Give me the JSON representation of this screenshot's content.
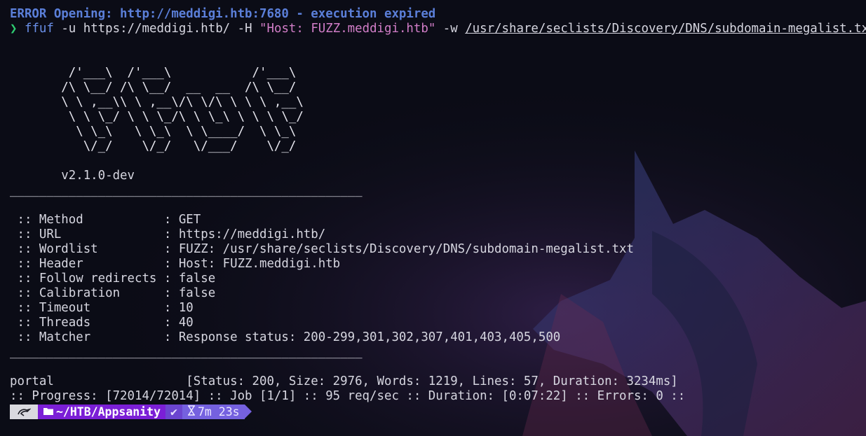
{
  "error_line": "ERROR Opening: http://meddigi.htb:7680 - execution expired",
  "command": {
    "prompt_symbol": "❯",
    "program": "ffuf",
    "args_before": " -u https://meddigi.htb/ -H ",
    "header_string": "\"Host: FUZZ.meddigi.htb\"",
    "args_mid": " -w ",
    "wordlist_path": "/usr/share/seclists/Discovery/DNS/subdomain-megalist.txt"
  },
  "banner": [
    "        /'___\\  /'___\\           /'___\\       ",
    "       /\\ \\__/ /\\ \\__/  __  __  /\\ \\__/       ",
    "       \\ \\ ,__\\\\ \\ ,__\\/\\ \\/\\ \\ \\ \\ ,__\\      ",
    "        \\ \\ \\_/ \\ \\ \\_/\\ \\ \\_\\ \\ \\ \\ \\_/      ",
    "         \\ \\_\\   \\ \\_\\  \\ \\____/  \\ \\_\\       ",
    "          \\/_/    \\/_/   \\/___/    \\/_/       "
  ],
  "version": "       v2.1.0-dev",
  "rule": "________________________________________________",
  "settings": [
    {
      "key": " :: Method           ",
      "value": ": GET"
    },
    {
      "key": " :: URL              ",
      "value": ": https://meddigi.htb/"
    },
    {
      "key": " :: Wordlist         ",
      "value": ": FUZZ: /usr/share/seclists/Discovery/DNS/subdomain-megalist.txt"
    },
    {
      "key": " :: Header           ",
      "value": ": Host: FUZZ.meddigi.htb"
    },
    {
      "key": " :: Follow redirects ",
      "value": ": false"
    },
    {
      "key": " :: Calibration      ",
      "value": ": false"
    },
    {
      "key": " :: Timeout          ",
      "value": ": 10"
    },
    {
      "key": " :: Threads          ",
      "value": ": 40"
    },
    {
      "key": " :: Matcher          ",
      "value": ": Response status: 200-299,301,302,307,401,403,405,500"
    }
  ],
  "result_line": "portal                  [Status: 200, Size: 2976, Words: 1219, Lines: 57, Duration: 3234ms]",
  "progress_line": ":: Progress: [72014/72014] :: Job [1/1] :: 95 req/sec :: Duration: [0:07:22] :: Errors: 0 ::",
  "status_bar": {
    "directory": "~/HTB/Appsanity",
    "ok_symbol": "✔",
    "elapsed": "7m 23s",
    "colors": {
      "dir_bg": "#7b1fd6",
      "ok_bg": "#6b45d0",
      "time_bg": "#7561df"
    }
  }
}
